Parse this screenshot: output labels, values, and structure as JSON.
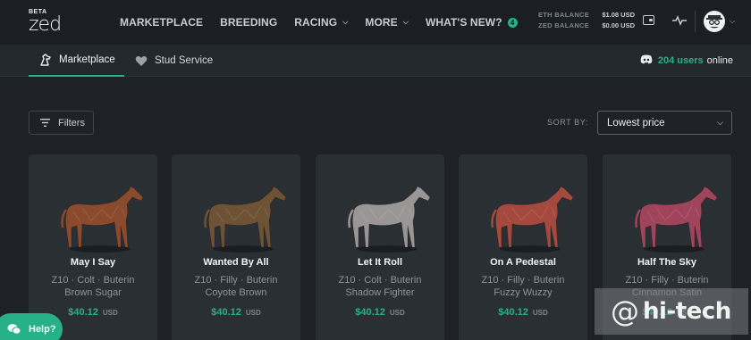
{
  "header": {
    "logo_beta": "BETA",
    "logo_text": "zed",
    "nav": [
      {
        "label": "MARKETPLACE"
      },
      {
        "label": "BREEDING"
      },
      {
        "label": "RACING"
      },
      {
        "label": "MORE"
      },
      {
        "label": "WHAT'S NEW?"
      }
    ],
    "whats_new_count": "4",
    "balances": {
      "eth_label": "ETH BALANCE",
      "eth_value": "$1.08 USD",
      "zed_label": "ZED BALANCE",
      "zed_value": "$0.00 USD"
    }
  },
  "subnav": {
    "tabs": [
      {
        "label": "Marketplace",
        "icon": "horse-icon",
        "active": true
      },
      {
        "label": "Stud Service",
        "icon": "heart-icon",
        "active": false
      }
    ],
    "users_count": "204 users",
    "users_suffix": "online"
  },
  "toolbar": {
    "filters_label": "Filters",
    "sort_label": "SORT BY:",
    "sort_value": "Lowest price"
  },
  "cards": [
    {
      "name": "May I Say",
      "gen": "Z10 · Colt · Buterin",
      "breed": "Brown Sugar",
      "price": "$40.12",
      "currency": "USD",
      "color": "#8a4a2e"
    },
    {
      "name": "Wanted By All",
      "gen": "Z10 · Filly · Buterin",
      "breed": "Coyote Brown",
      "price": "$40.12",
      "currency": "USD",
      "color": "#6e5235"
    },
    {
      "name": "Let It Roll",
      "gen": "Z10 · Colt · Buterin",
      "breed": "Shadow Fighter",
      "price": "$40.12",
      "currency": "USD",
      "color": "#9a9696"
    },
    {
      "name": "On A Pedestal",
      "gen": "Z10 · Filly · Buterin",
      "breed": "Fuzzy Wuzzy",
      "price": "$40.12",
      "currency": "USD",
      "color": "#a4493e"
    },
    {
      "name": "Half The Sky",
      "gen": "Z10 · Filly · Buterin",
      "breed": "Cinnamon Satin",
      "price": "$40.12",
      "currency": "USD",
      "color": "#a0445c"
    }
  ],
  "help": {
    "label": "Help?"
  },
  "watermark": {
    "text": "hi-tech"
  },
  "colors": {
    "accent": "#27b18a",
    "background": "#1e2226",
    "card": "#2a2f34"
  }
}
